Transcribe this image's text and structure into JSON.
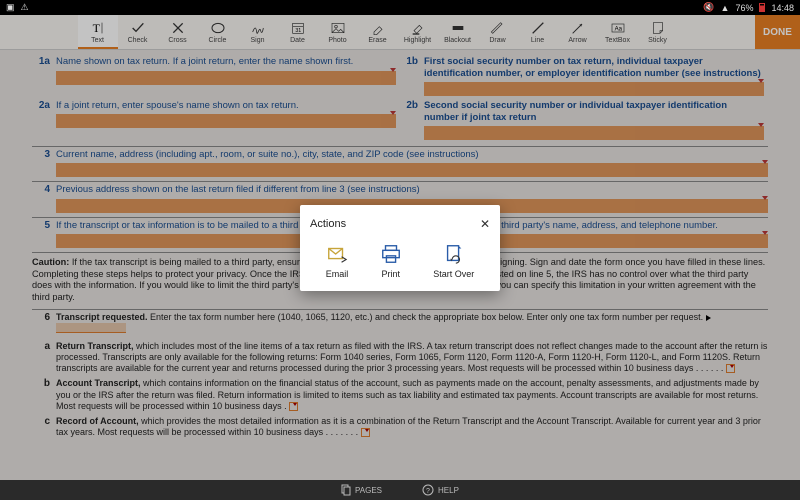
{
  "status": {
    "battery": "76%",
    "time": "14:48"
  },
  "toolbar": {
    "items": [
      {
        "label": "Text"
      },
      {
        "label": "Check"
      },
      {
        "label": "Cross"
      },
      {
        "label": "Circle"
      },
      {
        "label": "Sign"
      },
      {
        "label": "Date"
      },
      {
        "label": "Photo"
      },
      {
        "label": "Erase"
      },
      {
        "label": "Highlight"
      },
      {
        "label": "Blackout"
      },
      {
        "label": "Draw"
      },
      {
        "label": "Line"
      },
      {
        "label": "Arrow"
      },
      {
        "label": "TextBox"
      },
      {
        "label": "Sticky"
      }
    ],
    "done": "DONE"
  },
  "form": {
    "l1a": {
      "num": "1a",
      "text": "Name shown on tax return. If a joint return, enter the name shown first."
    },
    "l1b": {
      "num": "1b",
      "text": "First social security number on tax return, individual taxpayer identification number, or employer identification number (see instructions)"
    },
    "l2a": {
      "num": "2a",
      "text": "If a joint return, enter spouse's name shown on tax return."
    },
    "l2b": {
      "num": "2b",
      "text": "Second social security number or individual taxpayer identification number if joint tax return"
    },
    "l3": {
      "num": "3",
      "text": "Current name, address (including apt., room, or suite no.), city, state, and ZIP code (see instructions)"
    },
    "l4": {
      "num": "4",
      "text": "Previous address shown on the last return filed if different from line 3 (see instructions)"
    },
    "l5": {
      "num": "5",
      "text": "If the transcript or tax information is to be mailed to a third party (such as a mortgage company), enter the third party's name, address, and telephone number."
    },
    "caution_label": "Caution:",
    "caution": "If the tax transcript is being mailed to a third party, ensure that you have filled in lines 6 through 9 before signing. Sign and date the form once you have filled in these lines. Completing these steps helps to protect your privacy. Once the IRS discloses your tax transcript to the third party listed on line 5, the IRS has no control over what the third party does with the information. If you would like to limit the third party's authority to disclose your transcript information, you can specify this limitation in your written agreement with the third party.",
    "l6": {
      "num": "6",
      "lead": "Transcript requested.",
      "text": " Enter the tax form number here (1040, 1065, 1120, etc.) and check the appropriate box below. Enter only one tax form number per request. "
    },
    "la": {
      "num": "a",
      "lead": "Return Transcript,",
      "text": " which includes most of the line items of a tax return as filed with the IRS. A tax return transcript does not reflect changes made to the account after the return is processed. Transcripts are only available for the following returns: Form 1040 series, Form 1065, Form 1120, Form 1120-A, Form 1120-H, Form 1120-L, and Form 1120S. Return transcripts are available for the current year and returns processed during the prior 3 processing years. Most requests will be processed within 10 business days   .   .   .   .   .   ."
    },
    "lb": {
      "num": "b",
      "lead": "Account Transcript,",
      "text": " which contains information on the financial status of the account, such as payments made on the account, penalty assessments, and adjustments made by you or the IRS after the return was filed. Return information is limited to items such as tax liability and estimated tax payments. Account transcripts are available for most returns. Most requests will be processed within 10 business days   ."
    },
    "lc": {
      "num": "c",
      "lead": "Record of Account,",
      "text": " which provides the most detailed information as it is a combination of the Return Transcript and the Account Transcript. Available for current year and 3 prior tax years. Most requests will be processed within 10 business days   .   .   .   .   .   .   ."
    }
  },
  "bottom": {
    "pages": "PAGES",
    "help": "HELP"
  },
  "modal": {
    "title": "Actions",
    "email": "Email",
    "print": "Print",
    "start_over": "Start Over"
  }
}
